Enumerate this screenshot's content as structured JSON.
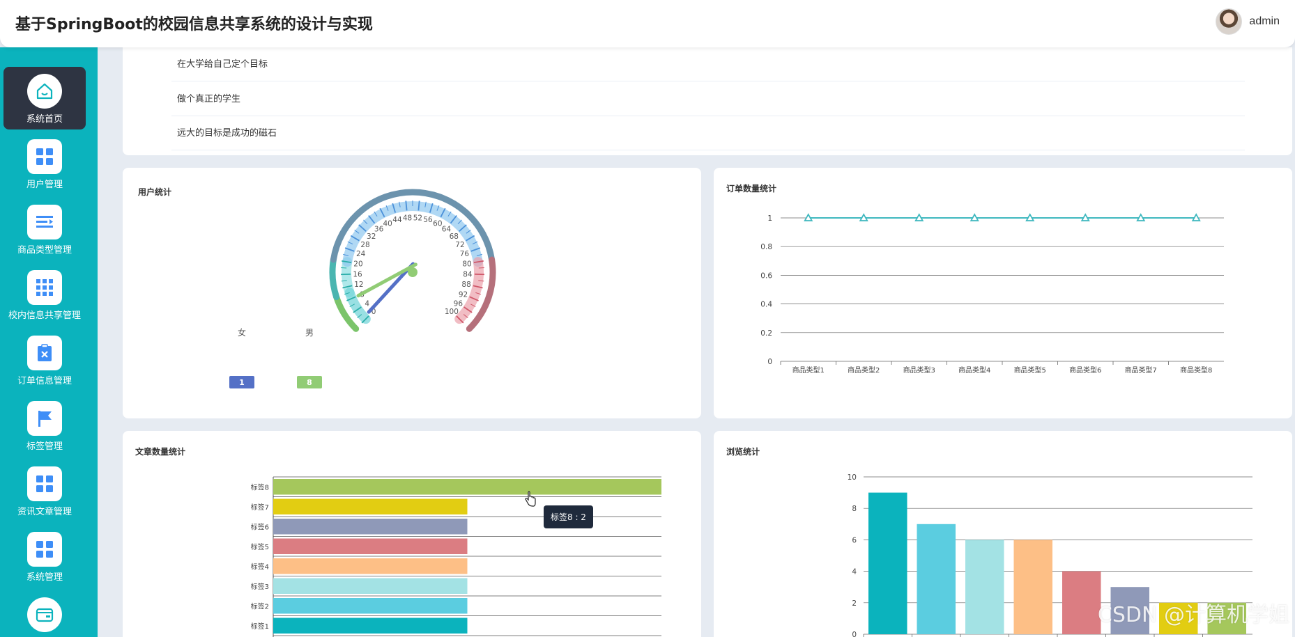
{
  "header": {
    "title": "基于SpringBoot的校园信息共享系统的设计与实现",
    "user_name": "admin"
  },
  "sidebar": {
    "items": [
      {
        "label": "系统首页",
        "icon": "home-icon",
        "active": true
      },
      {
        "label": "用户管理",
        "icon": "grid-icon",
        "active": false
      },
      {
        "label": "商品类型管理",
        "icon": "list-indent-icon",
        "active": false
      },
      {
        "label": "校内信息共享管理",
        "icon": "apps-icon",
        "active": false
      },
      {
        "label": "订单信息管理",
        "icon": "clipboard-x-icon",
        "active": false
      },
      {
        "label": "标签管理",
        "icon": "flag-icon",
        "active": false
      },
      {
        "label": "资讯文章管理",
        "icon": "grid-icon",
        "active": false
      },
      {
        "label": "系统管理",
        "icon": "grid-icon",
        "active": false
      },
      {
        "label": "",
        "icon": "wallet-icon",
        "active": false
      }
    ]
  },
  "slogans": [
    "在大学给自己定个目标",
    "做个真正的学生",
    "远大的目标是成功的磁石"
  ],
  "watermark": "CSDN @计算机学姐",
  "chart_data": [
    {
      "type": "gauge",
      "title": "用户统计",
      "min": 0,
      "max": 100,
      "ticks": [
        0,
        4,
        8,
        12,
        16,
        20,
        24,
        28,
        32,
        36,
        40,
        44,
        48,
        52,
        56,
        60,
        64,
        68,
        72,
        76,
        80,
        84,
        88,
        92,
        96,
        100
      ],
      "series": [
        {
          "name": "女",
          "value": 1,
          "color": "#5470c6"
        },
        {
          "name": "男",
          "value": 8,
          "color": "#91cc75"
        }
      ]
    },
    {
      "type": "line",
      "title": "订单数量统计",
      "categories": [
        "商品类型1",
        "商品类型2",
        "商品类型3",
        "商品类型4",
        "商品类型5",
        "商品类型6",
        "商品类型7",
        "商品类型8"
      ],
      "values": [
        1,
        1,
        1,
        1,
        1,
        1,
        1,
        1
      ],
      "ylim": [
        0,
        1
      ],
      "yticks": [
        "0",
        "0.2",
        "0.4",
        "0.6",
        "0.8",
        "1"
      ],
      "color": "#3fb8bf"
    },
    {
      "type": "bar",
      "orientation": "horizontal",
      "title": "文章数量统计",
      "categories": [
        "标签1",
        "标签2",
        "标签3",
        "标签4",
        "标签5",
        "标签6",
        "标签7",
        "标签8"
      ],
      "values": [
        1,
        1,
        1,
        1,
        1,
        1,
        1,
        2
      ],
      "xlim": [
        0,
        2
      ],
      "colors": [
        "#0bb3bd",
        "#5bcde0",
        "#a3e2e4",
        "#fdbf86",
        "#db7d82",
        "#8f99b8",
        "#e2cd12",
        "#a5c75c"
      ],
      "tooltip": "标签8 : 2"
    },
    {
      "type": "bar",
      "title": "浏览统计",
      "values": [
        9,
        7,
        6,
        6,
        4,
        3,
        2,
        2
      ],
      "ylim": [
        0,
        10
      ],
      "yticks": [
        "0",
        "2",
        "4",
        "6",
        "8",
        "10"
      ],
      "colors": [
        "#0bb3bd",
        "#5bcde0",
        "#a3e2e4",
        "#fdbf86",
        "#db7d82",
        "#8f99b8",
        "#e2cd12",
        "#a5c75c"
      ]
    }
  ]
}
